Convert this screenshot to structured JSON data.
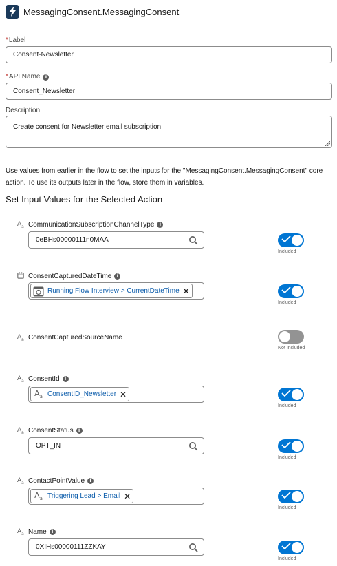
{
  "header": {
    "title": "MessagingConsent.MessagingConsent",
    "icon": "lightning-bolt-icon"
  },
  "form": {
    "label": {
      "caption": "Label",
      "value": "Consent-Newsletter"
    },
    "api_name": {
      "caption": "API Name",
      "value": "Consent_Newsletter"
    },
    "description": {
      "caption": "Description",
      "value": "Create consent for Newsletter email subscription."
    }
  },
  "help_text": "Use values from earlier in the flow to set the inputs for the \"MessagingConsent.MessagingConsent\" core action. To use its outputs later in the flow, store them in variables.",
  "section_title": "Set Input Values for the Selected Action",
  "inputs": [
    {
      "name": "CommunicationSubscriptionChannelType",
      "type_icon": "text-type-icon",
      "has_info": true,
      "value": "0eBHs00000111n0MAA",
      "pill": null,
      "included": true,
      "state_label": "Included"
    },
    {
      "name": "ConsentCapturedDateTime",
      "type_icon": "datetime-type-icon",
      "has_info": true,
      "value": null,
      "pill": "Running Flow Interview > CurrentDateTime",
      "included": true,
      "state_label": "Included"
    },
    {
      "name": "ConsentCapturedSourceName",
      "type_icon": "text-type-icon",
      "has_info": false,
      "value": null,
      "pill": null,
      "included": false,
      "state_label": "Not Included"
    },
    {
      "name": "ConsentId",
      "type_icon": "text-type-icon",
      "has_info": true,
      "value": null,
      "pill": "ConsentID_Newsletter",
      "included": true,
      "state_label": "Included"
    },
    {
      "name": "ConsentStatus",
      "type_icon": "text-type-icon",
      "has_info": true,
      "value": "OPT_IN",
      "pill": null,
      "included": true,
      "state_label": "Included"
    },
    {
      "name": "ContactPointValue",
      "type_icon": "text-type-icon",
      "has_info": true,
      "value": null,
      "pill": "Triggering Lead > Email",
      "included": true,
      "state_label": "Included"
    },
    {
      "name": "Name",
      "type_icon": "text-type-icon",
      "has_info": true,
      "value": "0XIHs00000111ZZKAY",
      "pill": null,
      "included": true,
      "state_label": "Included"
    }
  ],
  "colors": {
    "accent": "#0176d3",
    "link": "#0b5cab",
    "header_icon_bg": "#1b3a5a",
    "required": "#c23934"
  }
}
